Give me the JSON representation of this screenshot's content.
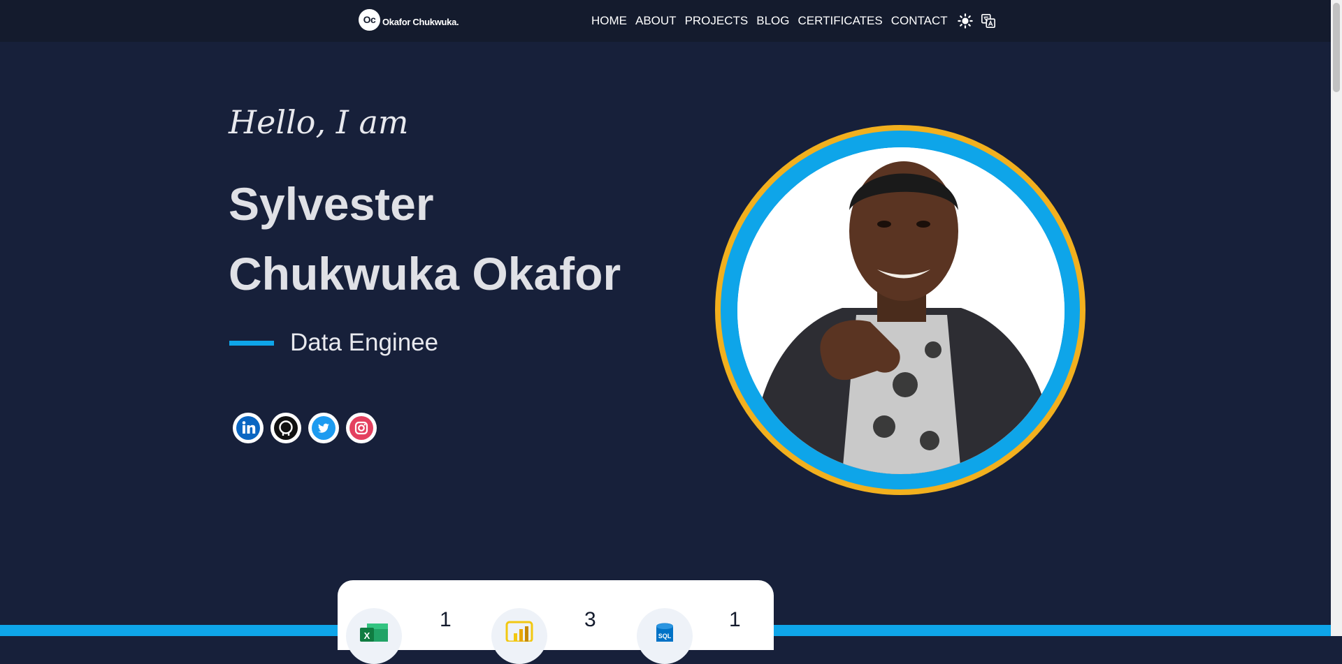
{
  "header": {
    "logo_initials": "Oc",
    "logo_name": "Okafor Chukwuka.",
    "nav": [
      "HOME",
      "ABOUT",
      "PROJECTS",
      "BLOG",
      "CERTIFICATES",
      "CONTACT"
    ],
    "icons": [
      "sun-icon",
      "translate-icon"
    ]
  },
  "hero": {
    "greeting": "Hello, I am",
    "name_line1": "Sylvester",
    "name_line2": "Chukwuka Okafor",
    "role": "Data Enginee",
    "accent_color": "#0ea5e9",
    "ring_color": "#f2b01e",
    "socials": [
      "linkedin-icon",
      "github-icon",
      "twitter-icon",
      "instagram-icon"
    ]
  },
  "stats": [
    {
      "icon": "excel-icon",
      "value": "1"
    },
    {
      "icon": "powerbi-icon",
      "value": "3"
    },
    {
      "icon": "sql-icon",
      "value": "1"
    }
  ]
}
